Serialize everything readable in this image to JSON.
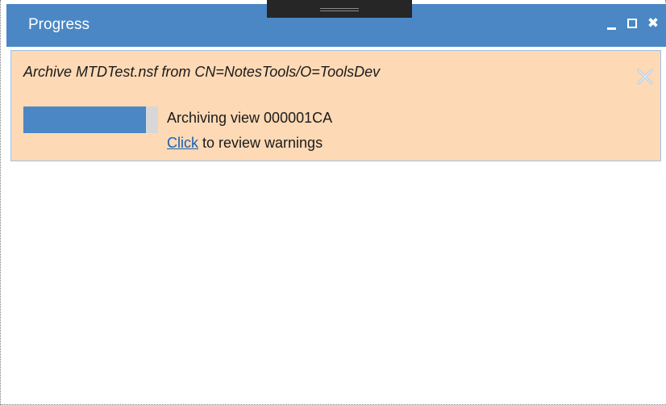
{
  "window": {
    "title": "Progress"
  },
  "task": {
    "title": "Archive MTDTest.nsf from CN=NotesTools/O=ToolsDev",
    "progress_fraction": 0.91,
    "status": "Archiving view 000001CA",
    "warnings_link_label": "Click",
    "warnings_suffix": " to review warnings"
  },
  "icons": {
    "minimize": "minimize-icon",
    "maximize": "maximize-icon",
    "close": "close-icon",
    "task_dismiss": "dismiss-x-icon"
  },
  "colors": {
    "titlebar": "#4a87c4",
    "task_background": "#fdd9b5",
    "progress_fill": "#4a87c4",
    "progress_track": "#d7d7d7",
    "link": "#1a5fb4"
  }
}
